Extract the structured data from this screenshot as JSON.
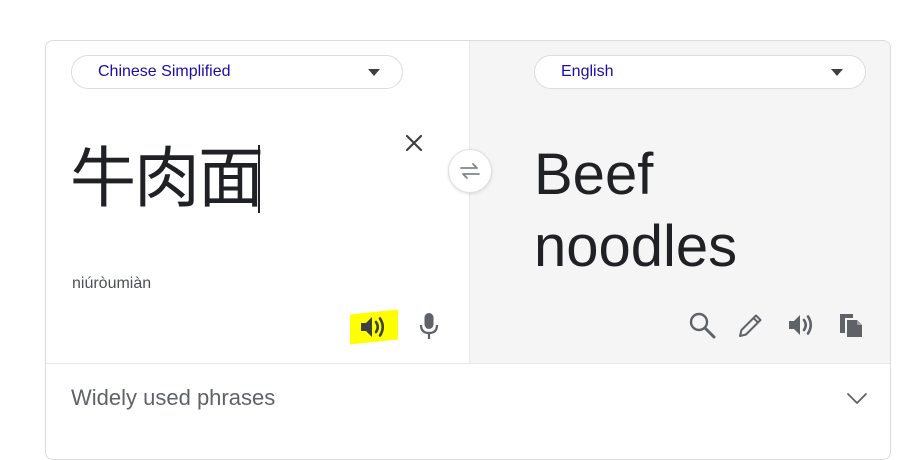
{
  "source_language": {
    "label": "Chinese Simplified",
    "icon": "caret-down-icon"
  },
  "target_language": {
    "label": "English",
    "icon": "caret-down-icon"
  },
  "source": {
    "text": "牛肉面",
    "romanization": "niúròumiàn"
  },
  "translation": {
    "line1": "Beef",
    "line2": "noodles"
  },
  "phrases": {
    "label": "Widely used phrases",
    "icon": "chevron-down-icon"
  },
  "colors": {
    "language_link": "#1a0dab",
    "highlight": "#ffff00",
    "right_panel_bg": "#f5f5f5",
    "icon": "#5f6368"
  },
  "icons": {
    "clear": "close-icon",
    "swap": "swap-icon",
    "source_speak": "speaker-icon",
    "mic": "microphone-icon",
    "search": "search-icon",
    "edit": "pencil-icon",
    "target_speak": "speaker-icon",
    "copy": "copy-icon"
  }
}
